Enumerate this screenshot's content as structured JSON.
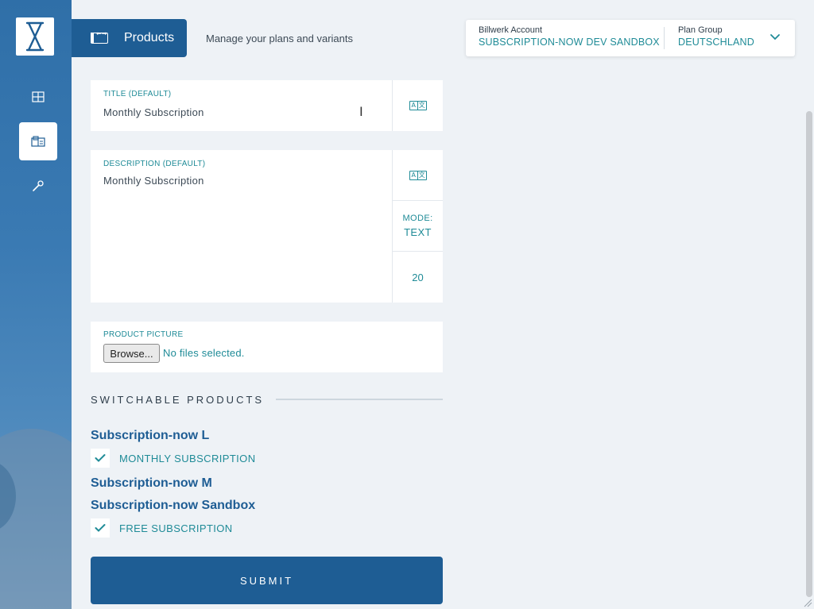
{
  "header": {
    "title": "Products",
    "subtitle": "Manage your plans and variants"
  },
  "account": {
    "billwerk_label": "Billwerk Account",
    "billwerk_value": "SUBSCRIPTION-NOW DEV SANDBOX",
    "plan_group_label": "Plan Group",
    "plan_group_value": "DEUTSCHLAND"
  },
  "sidebar": {
    "items": [
      {
        "name": "dashboard",
        "icon": "grid-icon",
        "active": false
      },
      {
        "name": "products",
        "icon": "products-icon",
        "active": true
      },
      {
        "name": "settings",
        "icon": "wrench-icon",
        "active": false
      }
    ]
  },
  "form": {
    "title_label": "TITLE (DEFAULT)",
    "title_value": "Monthly Subscription",
    "description_label": "DESCRIPTION (DEFAULT)",
    "description_value": "Monthly Subscription",
    "mode_label": "MODE:",
    "mode_value": "TEXT",
    "char_count": "20",
    "picture_label": "PRODUCT PICTURE",
    "browse_label": "Browse...",
    "no_files": "No files selected."
  },
  "switchable": {
    "section_title": "SWITCHABLE PRODUCTS",
    "groups": [
      {
        "name": "Subscription-now L",
        "items": [
          {
            "label": "MONTHLY SUBSCRIPTION",
            "checked": true
          }
        ]
      },
      {
        "name": "Subscription-now M",
        "items": []
      },
      {
        "name": "Subscription-now Sandbox",
        "items": [
          {
            "label": "FREE SUBSCRIPTION",
            "checked": true
          }
        ]
      }
    ]
  },
  "submit_label": "SUBMIT",
  "colors": {
    "primary": "#1e5d94",
    "accent": "#1f8b97",
    "background": "#eef2f6"
  }
}
